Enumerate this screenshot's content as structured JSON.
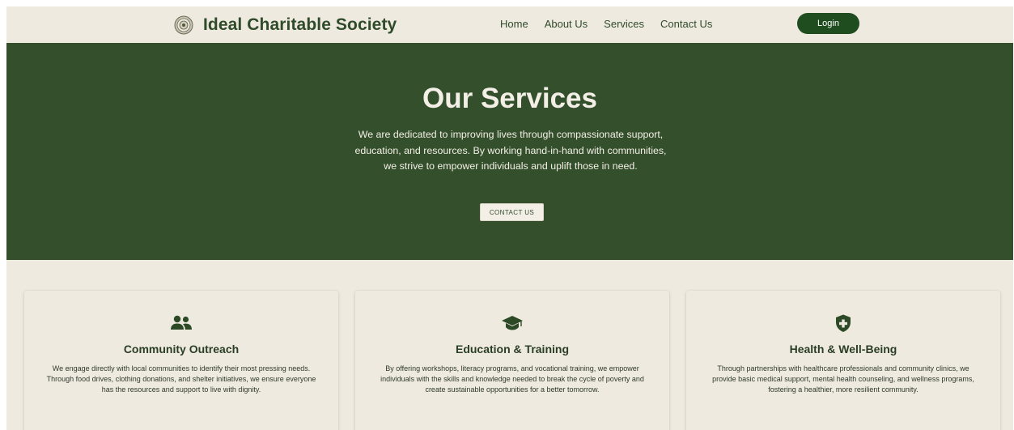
{
  "header": {
    "brand_name": "Ideal Charitable Society",
    "logo_icon": "seal-logo-icon",
    "nav": [
      "Home",
      "About Us",
      "Services",
      "Contact Us"
    ],
    "login_label": "Login"
  },
  "hero": {
    "title": "Our Services",
    "text": "We are dedicated to improving lives through compassionate support, education, and resources. By working hand-in-hand with communities, we strive to empower individuals and uplift those in need.",
    "button_label": "CONTACT US"
  },
  "services": [
    {
      "icon": "people-group-icon",
      "title": "Community Outreach",
      "text": "We engage directly with local communities to identify their most pressing needs. Through food drives, clothing donations, and shelter initiatives, we ensure everyone has the resources and support to live with dignity."
    },
    {
      "icon": "graduation-cap-icon",
      "title": "Education & Training",
      "text": "By offering workshops, literacy programs, and vocational training, we empower individuals with the skills and knowledge needed to break the cycle of poverty and create sustainable opportunities for a better tomorrow."
    },
    {
      "icon": "medical-shield-icon",
      "title": "Health & Well-Being",
      "text": "Through partnerships with healthcare professionals and community clinics, we provide basic medical support, mental health counseling, and wellness programs, fostering a healthier, more resilient community."
    }
  ],
  "colors": {
    "background": "#efeae0",
    "primary_green": "#334f2c",
    "button_green": "#1f4d20",
    "hero_text": "#f4efe6"
  }
}
